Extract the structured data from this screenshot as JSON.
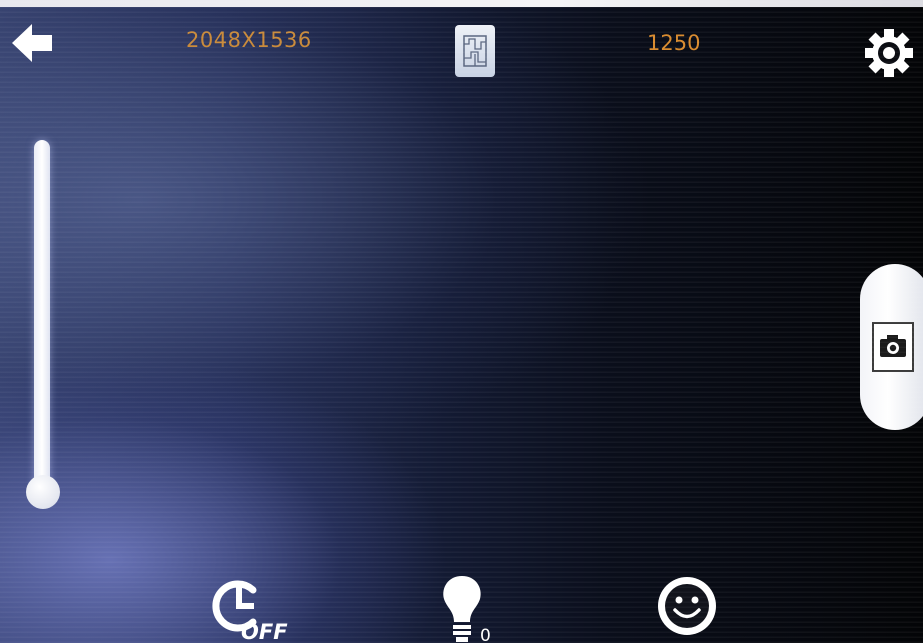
{
  "topbar": {
    "resolution": "2048X1536",
    "shots_remaining": "1250"
  },
  "bottombar": {
    "timer_label": "OFF",
    "light_level": "0"
  },
  "zoom": {
    "level": 0.0
  },
  "colors": {
    "resolution_text": "#c98a3a",
    "count_text": "#d98b2f",
    "icon": "#ffffff"
  },
  "icons": {
    "back": "back-arrow-icon",
    "storage": "sd-card-icon",
    "settings": "gear-icon",
    "capture": "camera-icon",
    "timer": "self-timer-icon",
    "light": "light-bulb-icon",
    "face": "smiley-face-icon"
  }
}
